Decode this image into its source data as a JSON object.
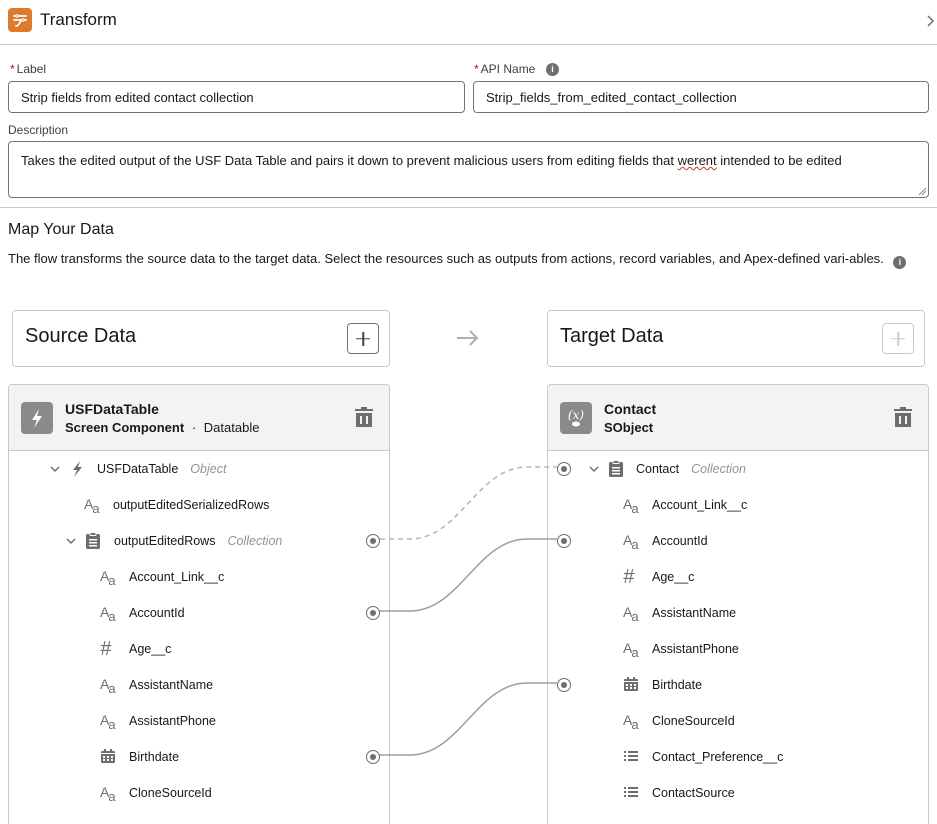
{
  "header": {
    "title": "Transform",
    "app_icon": "transform-icon",
    "collapse_icon": "chevron-right-icon"
  },
  "form": {
    "label": {
      "required_mark": "*",
      "label": "Label",
      "value": "Strip fields from edited contact collection"
    },
    "api_name": {
      "required_mark": "*",
      "label": "API Name",
      "info_icon": "info-icon",
      "value": "Strip_fields_from_edited_contact_collection"
    },
    "description": {
      "label": "Description",
      "value_before": "Takes the edited output of the USF Data Table and pairs it down to prevent malicious users from editing fields that ",
      "misspelled_word": "werent",
      "value_after": " intended to be edited"
    }
  },
  "map": {
    "title": "Map Your Data",
    "description": "The flow transforms the source data to the target data. Select the resources such as outputs from actions, record variables, and Apex-defined vari-ables.",
    "info_icon": "info-icon"
  },
  "source": {
    "box_title": "Source Data",
    "add_label": "+",
    "panel": {
      "name": "USFDataTable",
      "subtitle_bold": "Screen Component",
      "separator": "·",
      "subtitle": "Datatable",
      "icon": "lightning-icon"
    },
    "rows": [
      {
        "label": "USFDataTable",
        "type": "Object",
        "icon": "lightning-icon",
        "expandable": true,
        "level": 0,
        "connected": false
      },
      {
        "label": "outputEditedSerializedRows",
        "type": "",
        "icon": "text-icon",
        "expandable": false,
        "level": 1,
        "connected": false
      },
      {
        "label": "outputEditedRows",
        "type": "Collection",
        "icon": "clipboard-icon",
        "expandable": true,
        "level": 1,
        "connected": true
      },
      {
        "label": "Account_Link__c",
        "type": "",
        "icon": "text-icon",
        "expandable": false,
        "level": 2,
        "connected": false
      },
      {
        "label": "AccountId",
        "type": "",
        "icon": "text-icon",
        "expandable": false,
        "level": 2,
        "connected": true
      },
      {
        "label": "Age__c",
        "type": "",
        "icon": "number-icon",
        "expandable": false,
        "level": 2,
        "connected": false
      },
      {
        "label": "AssistantName",
        "type": "",
        "icon": "text-icon",
        "expandable": false,
        "level": 2,
        "connected": false
      },
      {
        "label": "AssistantPhone",
        "type": "",
        "icon": "text-icon",
        "expandable": false,
        "level": 2,
        "connected": false
      },
      {
        "label": "Birthdate",
        "type": "",
        "icon": "calendar-icon",
        "expandable": false,
        "level": 2,
        "connected": true
      },
      {
        "label": "CloneSourceId",
        "type": "",
        "icon": "text-icon",
        "expandable": false,
        "level": 2,
        "connected": false
      }
    ]
  },
  "target": {
    "box_title": "Target Data",
    "add_label": "+",
    "panel": {
      "name": "Contact",
      "subtitle_bold": "SObject",
      "icon": "variable-icon"
    },
    "rows": [
      {
        "label": "Contact",
        "type": "Collection",
        "icon": "clipboard-icon",
        "expandable": true,
        "level": 0,
        "connected": true
      },
      {
        "label": "Account_Link__c",
        "type": "",
        "icon": "text-icon",
        "expandable": false,
        "level": 1,
        "connected": false
      },
      {
        "label": "AccountId",
        "type": "",
        "icon": "text-icon",
        "expandable": false,
        "level": 1,
        "connected": true
      },
      {
        "label": "Age__c",
        "type": "",
        "icon": "number-icon",
        "expandable": false,
        "level": 1,
        "connected": false
      },
      {
        "label": "AssistantName",
        "type": "",
        "icon": "text-icon",
        "expandable": false,
        "level": 1,
        "connected": false
      },
      {
        "label": "AssistantPhone",
        "type": "",
        "icon": "text-icon",
        "expandable": false,
        "level": 1,
        "connected": false
      },
      {
        "label": "Birthdate",
        "type": "",
        "icon": "calendar-icon",
        "expandable": false,
        "level": 1,
        "connected": true
      },
      {
        "label": "CloneSourceId",
        "type": "",
        "icon": "text-icon",
        "expandable": false,
        "level": 1,
        "connected": false
      },
      {
        "label": "Contact_Preference__c",
        "type": "",
        "icon": "picklist-icon",
        "expandable": false,
        "level": 1,
        "connected": false
      },
      {
        "label": "ContactSource",
        "type": "",
        "icon": "picklist-icon",
        "expandable": false,
        "level": 1,
        "connected": false
      }
    ]
  },
  "mappings": [
    {
      "from": "outputEditedRows",
      "to": "Contact",
      "style": "dashed"
    },
    {
      "from": "AccountId",
      "to": "AccountId",
      "style": "solid"
    },
    {
      "from": "Birthdate",
      "to": "Birthdate",
      "style": "solid"
    }
  ],
  "colors": {
    "accent": "#dd7a2b",
    "required": "#ba0517",
    "border": "#c9c9c9",
    "icon_gray": "#706e6b",
    "panel_header_bg": "#f3f3f3"
  }
}
